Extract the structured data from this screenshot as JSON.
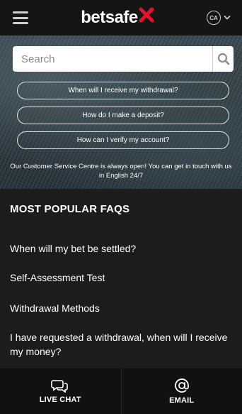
{
  "header": {
    "menu_icon": "hamburger-icon",
    "logo_text": "betsafe",
    "logo_mark_color": "#e8112d",
    "country_code": "CA"
  },
  "hero": {
    "search_placeholder": "Search",
    "search_icon": "search-icon",
    "quick_links": [
      "When will I receive my withdrawal?",
      "How do I make a deposit?",
      "How can I verify my account?"
    ],
    "note": "Our Customer Service Centre is always open! You can get in touch with us in English 24/7"
  },
  "popular": {
    "title": "MOST POPULAR FAQS",
    "items": [
      "When will my bet be settled?",
      "Self-Assessment Test",
      "Withdrawal Methods",
      "I have requested a withdrawal, when will I receive my money?"
    ]
  },
  "bottom_bar": {
    "live_chat_label": "LIVE CHAT",
    "live_chat_icon": "chat-bubbles-icon",
    "email_label": "EMAIL",
    "email_icon": "at-sign-icon"
  }
}
